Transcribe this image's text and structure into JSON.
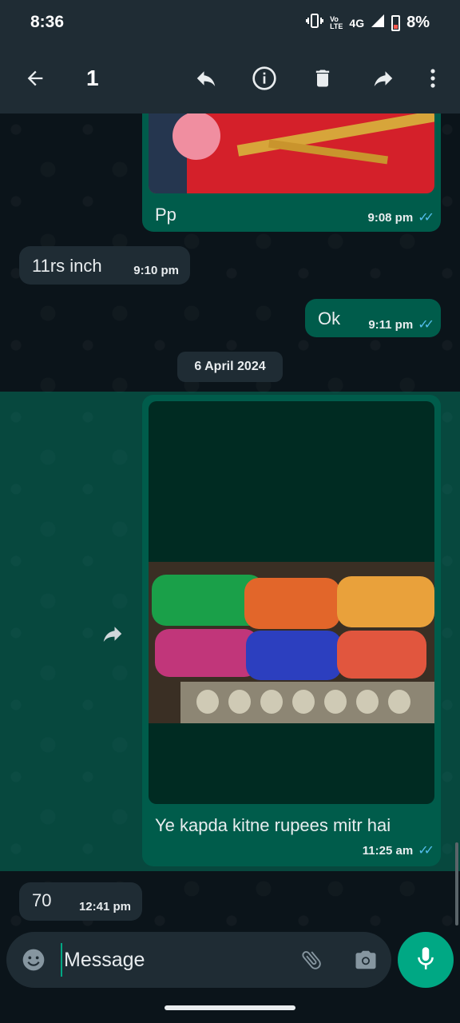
{
  "status_bar": {
    "time": "8:36",
    "network": "4G",
    "battery": "8%"
  },
  "app_bar": {
    "selected_count": "1",
    "icons": [
      "back-icon",
      "reply-icon",
      "info-icon",
      "delete-icon",
      "forward-icon",
      "more-icon"
    ]
  },
  "messages": [
    {
      "direction": "out",
      "type": "image",
      "caption": "Pp",
      "time": "9:08 pm",
      "status": "read"
    },
    {
      "direction": "in",
      "type": "text",
      "text": "11rs inch",
      "time": "9:10 pm"
    },
    {
      "direction": "out",
      "type": "text",
      "text": "Ok",
      "time": "9:11 pm",
      "status": "read"
    },
    {
      "direction": "out",
      "type": "image",
      "caption": "Ye kapda kitne rupees mitr hai",
      "time": "11:25 am",
      "status": "read",
      "selected": true
    },
    {
      "direction": "in",
      "type": "text",
      "text": "70",
      "time": "12:41 pm"
    }
  ],
  "date_divider": "6 April 2024",
  "composer": {
    "placeholder": "Message"
  },
  "colors": {
    "accent": "#00a884",
    "outgoing_bubble": "#005c4b",
    "incoming_bubble": "#1f2c34",
    "read_ticks": "#53bdeb",
    "background": "#0b141a"
  }
}
